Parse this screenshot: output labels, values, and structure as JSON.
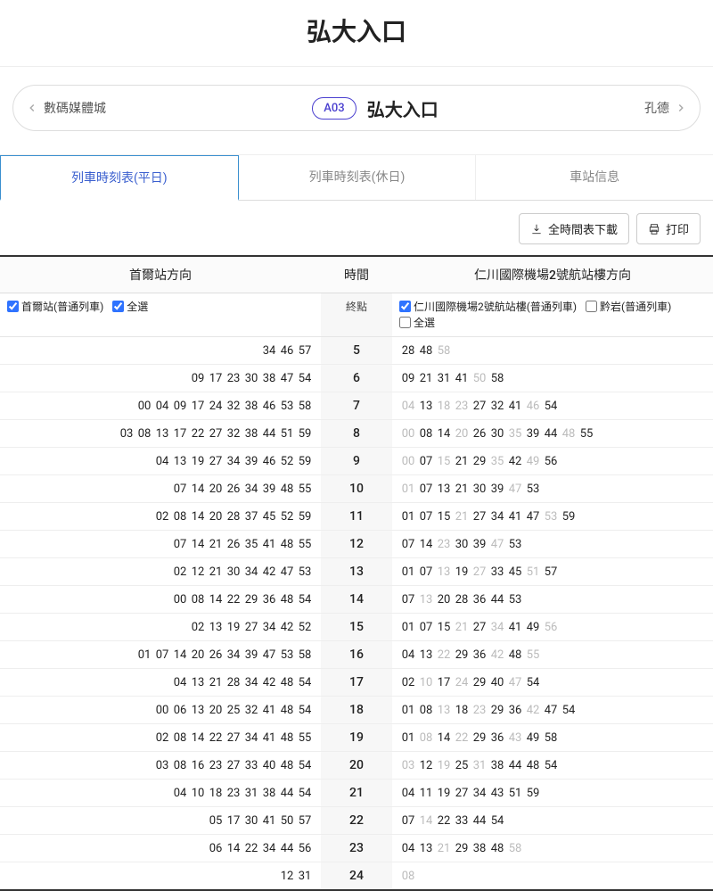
{
  "title": "弘大入口",
  "nav": {
    "prev": "數碼媒體城",
    "code": "A03",
    "name": "弘大入口",
    "next": "孔德"
  },
  "tabs": [
    "列車時刻表(平日)",
    "列車時刻表(休日)",
    "車站信息"
  ],
  "active_tab": 0,
  "tools": {
    "download": "全時間表下載",
    "print": "打印"
  },
  "heads": {
    "left": "首爾站方向",
    "mid": "時間",
    "right": "仁川國際機場2號航站樓方向",
    "term": "終點"
  },
  "filters": {
    "left": [
      {
        "label": "首爾站(普通列車)",
        "checked": true
      },
      {
        "label": "全選",
        "checked": true
      }
    ],
    "right": [
      {
        "label": "仁川國際機場2號航站樓(普通列車)",
        "checked": true
      },
      {
        "label": "黔岩(普通列車)",
        "checked": false
      },
      {
        "label": "全選",
        "checked": false
      }
    ]
  },
  "rows": [
    {
      "h": "5",
      "L": [
        [
          "34",
          0
        ],
        [
          "46",
          0
        ],
        [
          "57",
          0
        ]
      ],
      "R": [
        [
          "28",
          0
        ],
        [
          "48",
          0
        ],
        [
          "58",
          1
        ]
      ]
    },
    {
      "h": "6",
      "L": [
        [
          "09",
          0
        ],
        [
          "17",
          0
        ],
        [
          "23",
          0
        ],
        [
          "30",
          0
        ],
        [
          "38",
          0
        ],
        [
          "47",
          0
        ],
        [
          "54",
          0
        ]
      ],
      "R": [
        [
          "09",
          0
        ],
        [
          "21",
          0
        ],
        [
          "31",
          0
        ],
        [
          "41",
          0
        ],
        [
          "50",
          1
        ],
        [
          "58",
          0
        ]
      ]
    },
    {
      "h": "7",
      "L": [
        [
          "00",
          0
        ],
        [
          "04",
          0
        ],
        [
          "09",
          0
        ],
        [
          "17",
          0
        ],
        [
          "24",
          0
        ],
        [
          "32",
          0
        ],
        [
          "38",
          0
        ],
        [
          "46",
          0
        ],
        [
          "53",
          0
        ],
        [
          "58",
          0
        ]
      ],
      "R": [
        [
          "04",
          1
        ],
        [
          "13",
          0
        ],
        [
          "18",
          1
        ],
        [
          "23",
          1
        ],
        [
          "27",
          0
        ],
        [
          "32",
          0
        ],
        [
          "41",
          0
        ],
        [
          "46",
          1
        ],
        [
          "54",
          0
        ]
      ]
    },
    {
      "h": "8",
      "L": [
        [
          "03",
          0
        ],
        [
          "08",
          0
        ],
        [
          "13",
          0
        ],
        [
          "17",
          0
        ],
        [
          "22",
          0
        ],
        [
          "27",
          0
        ],
        [
          "32",
          0
        ],
        [
          "38",
          0
        ],
        [
          "44",
          0
        ],
        [
          "51",
          0
        ],
        [
          "59",
          0
        ]
      ],
      "R": [
        [
          "00",
          1
        ],
        [
          "08",
          0
        ],
        [
          "14",
          0
        ],
        [
          "20",
          1
        ],
        [
          "26",
          0
        ],
        [
          "30",
          0
        ],
        [
          "35",
          1
        ],
        [
          "39",
          0
        ],
        [
          "44",
          0
        ],
        [
          "48",
          1
        ],
        [
          "55",
          0
        ]
      ]
    },
    {
      "h": "9",
      "L": [
        [
          "04",
          0
        ],
        [
          "13",
          0
        ],
        [
          "19",
          0
        ],
        [
          "27",
          0
        ],
        [
          "34",
          0
        ],
        [
          "39",
          0
        ],
        [
          "46",
          0
        ],
        [
          "52",
          0
        ],
        [
          "59",
          0
        ]
      ],
      "R": [
        [
          "00",
          1
        ],
        [
          "07",
          0
        ],
        [
          "15",
          1
        ],
        [
          "21",
          0
        ],
        [
          "29",
          0
        ],
        [
          "35",
          1
        ],
        [
          "42",
          0
        ],
        [
          "49",
          1
        ],
        [
          "56",
          0
        ]
      ]
    },
    {
      "h": "10",
      "L": [
        [
          "07",
          0
        ],
        [
          "14",
          0
        ],
        [
          "20",
          0
        ],
        [
          "26",
          0
        ],
        [
          "34",
          0
        ],
        [
          "39",
          0
        ],
        [
          "48",
          0
        ],
        [
          "55",
          0
        ]
      ],
      "R": [
        [
          "01",
          1
        ],
        [
          "07",
          0
        ],
        [
          "13",
          0
        ],
        [
          "21",
          0
        ],
        [
          "30",
          0
        ],
        [
          "39",
          0
        ],
        [
          "47",
          1
        ],
        [
          "53",
          0
        ]
      ]
    },
    {
      "h": "11",
      "L": [
        [
          "02",
          0
        ],
        [
          "08",
          0
        ],
        [
          "14",
          0
        ],
        [
          "20",
          0
        ],
        [
          "28",
          0
        ],
        [
          "37",
          0
        ],
        [
          "45",
          0
        ],
        [
          "52",
          0
        ],
        [
          "59",
          0
        ]
      ],
      "R": [
        [
          "01",
          0
        ],
        [
          "07",
          0
        ],
        [
          "15",
          0
        ],
        [
          "21",
          1
        ],
        [
          "27",
          0
        ],
        [
          "34",
          0
        ],
        [
          "41",
          0
        ],
        [
          "47",
          0
        ],
        [
          "53",
          1
        ],
        [
          "59",
          0
        ]
      ]
    },
    {
      "h": "12",
      "L": [
        [
          "07",
          0
        ],
        [
          "14",
          0
        ],
        [
          "21",
          0
        ],
        [
          "26",
          0
        ],
        [
          "35",
          0
        ],
        [
          "41",
          0
        ],
        [
          "48",
          0
        ],
        [
          "55",
          0
        ]
      ],
      "R": [
        [
          "07",
          0
        ],
        [
          "14",
          0
        ],
        [
          "23",
          1
        ],
        [
          "30",
          0
        ],
        [
          "39",
          0
        ],
        [
          "47",
          1
        ],
        [
          "53",
          0
        ]
      ]
    },
    {
      "h": "13",
      "L": [
        [
          "02",
          0
        ],
        [
          "12",
          0
        ],
        [
          "21",
          0
        ],
        [
          "30",
          0
        ],
        [
          "34",
          0
        ],
        [
          "42",
          0
        ],
        [
          "47",
          0
        ],
        [
          "53",
          0
        ]
      ],
      "R": [
        [
          "01",
          0
        ],
        [
          "07",
          0
        ],
        [
          "13",
          1
        ],
        [
          "19",
          0
        ],
        [
          "27",
          1
        ],
        [
          "33",
          0
        ],
        [
          "45",
          0
        ],
        [
          "51",
          1
        ],
        [
          "57",
          0
        ]
      ]
    },
    {
      "h": "14",
      "L": [
        [
          "00",
          0
        ],
        [
          "08",
          0
        ],
        [
          "14",
          0
        ],
        [
          "22",
          0
        ],
        [
          "29",
          0
        ],
        [
          "36",
          0
        ],
        [
          "48",
          0
        ],
        [
          "54",
          0
        ]
      ],
      "R": [
        [
          "07",
          0
        ],
        [
          "13",
          1
        ],
        [
          "20",
          0
        ],
        [
          "28",
          0
        ],
        [
          "36",
          0
        ],
        [
          "44",
          0
        ],
        [
          "53",
          0
        ]
      ]
    },
    {
      "h": "15",
      "L": [
        [
          "02",
          0
        ],
        [
          "13",
          0
        ],
        [
          "19",
          0
        ],
        [
          "27",
          0
        ],
        [
          "34",
          0
        ],
        [
          "42",
          0
        ],
        [
          "52",
          0
        ]
      ],
      "R": [
        [
          "01",
          0
        ],
        [
          "07",
          0
        ],
        [
          "15",
          0
        ],
        [
          "21",
          1
        ],
        [
          "27",
          0
        ],
        [
          "34",
          1
        ],
        [
          "41",
          0
        ],
        [
          "49",
          0
        ],
        [
          "56",
          1
        ]
      ]
    },
    {
      "h": "16",
      "L": [
        [
          "01",
          0
        ],
        [
          "07",
          0
        ],
        [
          "14",
          0
        ],
        [
          "20",
          0
        ],
        [
          "26",
          0
        ],
        [
          "34",
          0
        ],
        [
          "39",
          0
        ],
        [
          "47",
          0
        ],
        [
          "53",
          0
        ],
        [
          "58",
          0
        ]
      ],
      "R": [
        [
          "04",
          0
        ],
        [
          "13",
          0
        ],
        [
          "22",
          1
        ],
        [
          "29",
          0
        ],
        [
          "36",
          0
        ],
        [
          "42",
          1
        ],
        [
          "48",
          0
        ],
        [
          "55",
          1
        ]
      ]
    },
    {
      "h": "17",
      "L": [
        [
          "04",
          0
        ],
        [
          "13",
          0
        ],
        [
          "21",
          0
        ],
        [
          "28",
          0
        ],
        [
          "34",
          0
        ],
        [
          "42",
          0
        ],
        [
          "48",
          0
        ],
        [
          "54",
          0
        ]
      ],
      "R": [
        [
          "02",
          0
        ],
        [
          "10",
          1
        ],
        [
          "17",
          0
        ],
        [
          "24",
          1
        ],
        [
          "29",
          0
        ],
        [
          "40",
          0
        ],
        [
          "47",
          1
        ],
        [
          "54",
          0
        ]
      ]
    },
    {
      "h": "18",
      "L": [
        [
          "00",
          0
        ],
        [
          "06",
          0
        ],
        [
          "13",
          0
        ],
        [
          "20",
          0
        ],
        [
          "25",
          0
        ],
        [
          "32",
          0
        ],
        [
          "41",
          0
        ],
        [
          "48",
          0
        ],
        [
          "54",
          0
        ]
      ],
      "R": [
        [
          "01",
          0
        ],
        [
          "08",
          0
        ],
        [
          "13",
          1
        ],
        [
          "18",
          0
        ],
        [
          "23",
          1
        ],
        [
          "29",
          0
        ],
        [
          "36",
          0
        ],
        [
          "42",
          1
        ],
        [
          "47",
          0
        ],
        [
          "54",
          0
        ]
      ]
    },
    {
      "h": "19",
      "L": [
        [
          "02",
          0
        ],
        [
          "08",
          0
        ],
        [
          "14",
          0
        ],
        [
          "22",
          0
        ],
        [
          "27",
          0
        ],
        [
          "34",
          0
        ],
        [
          "41",
          0
        ],
        [
          "48",
          0
        ],
        [
          "55",
          0
        ]
      ],
      "R": [
        [
          "01",
          0
        ],
        [
          "08",
          1
        ],
        [
          "14",
          0
        ],
        [
          "22",
          1
        ],
        [
          "29",
          0
        ],
        [
          "36",
          0
        ],
        [
          "43",
          1
        ],
        [
          "49",
          0
        ],
        [
          "58",
          0
        ]
      ]
    },
    {
      "h": "20",
      "L": [
        [
          "03",
          0
        ],
        [
          "08",
          0
        ],
        [
          "16",
          0
        ],
        [
          "23",
          0
        ],
        [
          "27",
          0
        ],
        [
          "33",
          0
        ],
        [
          "40",
          0
        ],
        [
          "48",
          0
        ],
        [
          "54",
          0
        ]
      ],
      "R": [
        [
          "03",
          1
        ],
        [
          "12",
          0
        ],
        [
          "19",
          1
        ],
        [
          "25",
          0
        ],
        [
          "31",
          1
        ],
        [
          "38",
          0
        ],
        [
          "44",
          0
        ],
        [
          "48",
          0
        ],
        [
          "54",
          0
        ]
      ]
    },
    {
      "h": "21",
      "L": [
        [
          "04",
          0
        ],
        [
          "10",
          0
        ],
        [
          "18",
          0
        ],
        [
          "23",
          0
        ],
        [
          "31",
          0
        ],
        [
          "38",
          0
        ],
        [
          "44",
          0
        ],
        [
          "54",
          0
        ]
      ],
      "R": [
        [
          "04",
          0
        ],
        [
          "11",
          0
        ],
        [
          "19",
          0
        ],
        [
          "27",
          0
        ],
        [
          "34",
          0
        ],
        [
          "43",
          0
        ],
        [
          "51",
          0
        ],
        [
          "59",
          0
        ]
      ]
    },
    {
      "h": "22",
      "L": [
        [
          "05",
          0
        ],
        [
          "17",
          0
        ],
        [
          "30",
          0
        ],
        [
          "41",
          0
        ],
        [
          "50",
          0
        ],
        [
          "57",
          0
        ]
      ],
      "R": [
        [
          "07",
          0
        ],
        [
          "14",
          1
        ],
        [
          "22",
          0
        ],
        [
          "33",
          0
        ],
        [
          "44",
          0
        ],
        [
          "54",
          0
        ]
      ]
    },
    {
      "h": "23",
      "L": [
        [
          "06",
          0
        ],
        [
          "14",
          0
        ],
        [
          "22",
          0
        ],
        [
          "34",
          0
        ],
        [
          "44",
          0
        ],
        [
          "56",
          0
        ]
      ],
      "R": [
        [
          "04",
          0
        ],
        [
          "13",
          0
        ],
        [
          "21",
          1
        ],
        [
          "29",
          0
        ],
        [
          "38",
          0
        ],
        [
          "48",
          0
        ],
        [
          "58",
          1
        ]
      ]
    },
    {
      "h": "24",
      "L": [
        [
          "12",
          0
        ],
        [
          "31",
          0
        ]
      ],
      "R": [
        [
          "08",
          1
        ]
      ]
    }
  ]
}
